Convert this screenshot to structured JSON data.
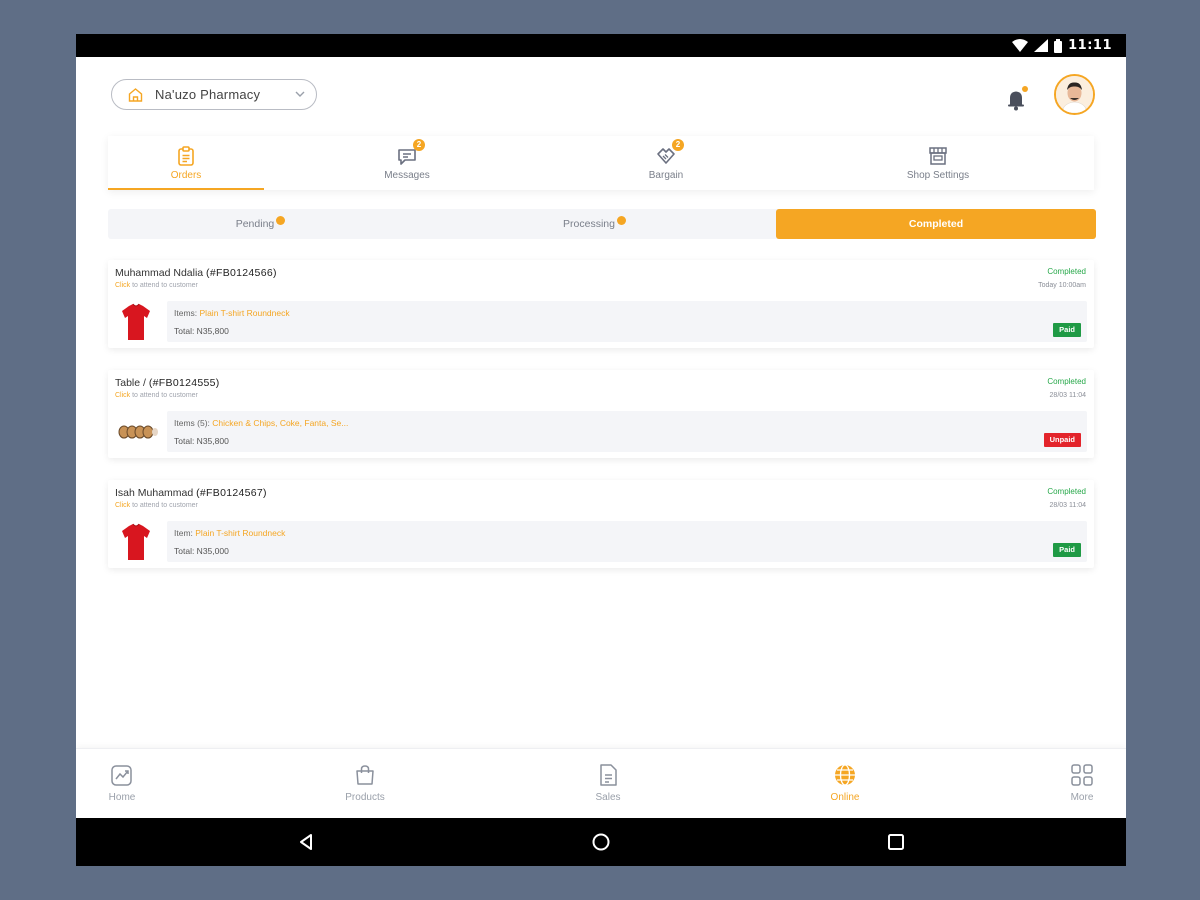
{
  "status_bar": {
    "time": "11:11"
  },
  "header": {
    "store_name": "Na'uzo Pharmacy"
  },
  "top_tabs": [
    {
      "label": "Orders",
      "badge": ""
    },
    {
      "label": "Messages",
      "badge": "2"
    },
    {
      "label": "Bargain",
      "badge": "2"
    },
    {
      "label": "Shop Settings",
      "badge": ""
    }
  ],
  "sub_tabs": [
    {
      "label": "Pending"
    },
    {
      "label": "Processing"
    },
    {
      "label": "Completed"
    }
  ],
  "orders": [
    {
      "customer": "Muhammad Ndalia",
      "order_id": "(#FB0124566)",
      "hint_click": "Click",
      "hint_rest": " to attend to customer",
      "status": "Completed",
      "time": "Today 10:00am",
      "items_label": "Items: ",
      "items_value": "Plain T-shirt Roundneck",
      "total": "Total: N35,800",
      "payment": "Paid"
    },
    {
      "customer": "Table /",
      "order_id": "(#FB0124555)",
      "hint_click": "Click",
      "hint_rest": " to attend to customer",
      "status": "Completed",
      "time": "28/03 11:04",
      "items_label": "Items (5): ",
      "items_value": "Chicken & Chips, Coke, Fanta, Se...",
      "total": "Total: N35,800",
      "payment": "Unpaid"
    },
    {
      "customer": "Isah Muhammad",
      "order_id": "(#FB0124567)",
      "hint_click": "Click",
      "hint_rest": " to attend to customer",
      "status": "Completed",
      "time": "28/03 11:04",
      "items_label": "Item: ",
      "items_value": "Plain T-shirt Roundneck",
      "total": "Total: N35,000",
      "payment": "Paid"
    }
  ],
  "bottom_nav": [
    {
      "label": "Home"
    },
    {
      "label": "Products"
    },
    {
      "label": "Sales"
    },
    {
      "label": "Online"
    },
    {
      "label": "More"
    }
  ],
  "colors": {
    "accent": "#f5a623",
    "paid": "#1f9a45",
    "unpaid": "#e3242b",
    "completed_text": "#27a84a",
    "backdrop": "#5f6e86"
  },
  "icons": {
    "store": "store-icon",
    "bell": "bell-icon",
    "orders": "clipboard-icon",
    "messages": "chat-icon",
    "bargain": "handshake-icon",
    "shop_settings": "storefront-icon",
    "home": "chart-icon",
    "products": "shopping-bag-icon",
    "sales": "document-icon",
    "online": "globe-icon",
    "more": "grid-icon"
  }
}
